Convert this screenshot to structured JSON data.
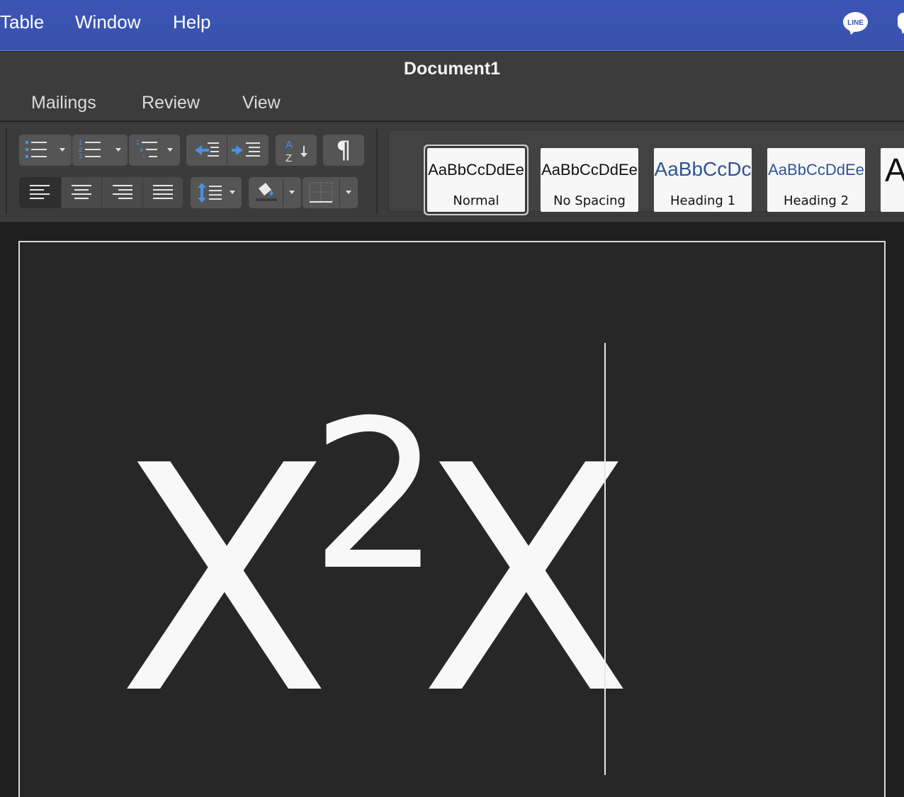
{
  "menubar": {
    "items": [
      "Table",
      "Window",
      "Help"
    ],
    "status_icons": [
      "line-app-icon",
      "chat-bubble-icon"
    ],
    "line_label": "LINE"
  },
  "window": {
    "title": "Document1",
    "tabs": [
      "Mailings",
      "Review",
      "View"
    ]
  },
  "ribbon": {
    "paragraph_buttons": [
      "bullets-icon",
      "numbering-icon",
      "multilevel-list-icon",
      "decrease-indent-icon",
      "increase-indent-icon",
      "sort-icon",
      "show-formatting-marks-icon",
      "align-left-icon",
      "align-center-icon",
      "align-right-icon",
      "justify-icon",
      "line-spacing-icon",
      "shading-icon",
      "borders-icon"
    ],
    "sort_letters": {
      "a": "A",
      "z": "Z"
    },
    "pilcrow": "¶",
    "styles": [
      {
        "sample": "AaBbCcDdEe",
        "name": "Normal",
        "selected": true,
        "color": "#111111"
      },
      {
        "sample": "AaBbCcDdEe",
        "name": "No Spacing",
        "selected": false,
        "color": "#111111"
      },
      {
        "sample": "AaBbCcDc",
        "name": "Heading 1",
        "selected": false,
        "color": "#2f5597"
      },
      {
        "sample": "AaBbCcDdEe",
        "name": "Heading 2",
        "selected": false,
        "color": "#2f5597"
      },
      {
        "sample": "A",
        "name": "",
        "selected": false,
        "color": "#111111"
      }
    ]
  },
  "document": {
    "base1": "X",
    "superscript": "2",
    "base2": "X"
  },
  "colors": {
    "menubar": "#3b55b5",
    "accent_blue": "#4a90e2",
    "page_background": "#272727"
  }
}
